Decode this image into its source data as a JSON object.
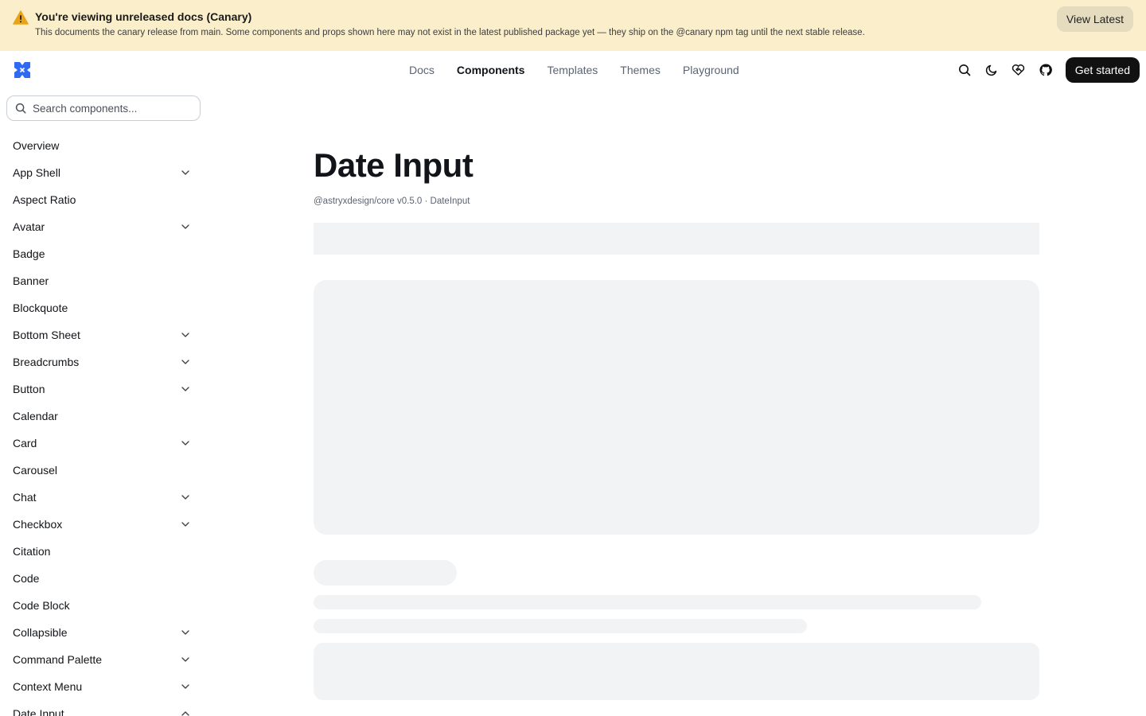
{
  "banner": {
    "title": "You're viewing unreleased docs (Canary)",
    "description": "This documents the canary release from main. Some components and props shown here may not exist in the latest published package yet — they ship on the @canary npm tag until the next stable release.",
    "button_label": "View Latest",
    "warning_color": "#e8a317"
  },
  "header": {
    "logo_icon": "logo-icon",
    "brand_color": "#2f6bf2",
    "nav": [
      "Docs",
      "Components",
      "Templates",
      "Themes",
      "Playground"
    ],
    "active_nav": "Components",
    "actions": [
      "search-icon",
      "theme-toggle-icon",
      "sponsor-icon",
      "github-icon"
    ],
    "cta_label": "Get started"
  },
  "sidebar": {
    "search_placeholder": "Search components...",
    "items": [
      {
        "label": "Overview",
        "expandable": false
      },
      {
        "label": "App Shell",
        "expandable": true
      },
      {
        "label": "Aspect Ratio",
        "expandable": false
      },
      {
        "label": "Avatar",
        "expandable": true
      },
      {
        "label": "Badge",
        "expandable": false
      },
      {
        "label": "Banner",
        "expandable": false
      },
      {
        "label": "Blockquote",
        "expandable": false
      },
      {
        "label": "Bottom Sheet",
        "expandable": true
      },
      {
        "label": "Breadcrumbs",
        "expandable": true
      },
      {
        "label": "Button",
        "expandable": true
      },
      {
        "label": "Calendar",
        "expandable": false
      },
      {
        "label": "Card",
        "expandable": true
      },
      {
        "label": "Carousel",
        "expandable": false
      },
      {
        "label": "Chat",
        "expandable": true
      },
      {
        "label": "Checkbox",
        "expandable": true
      },
      {
        "label": "Citation",
        "expandable": false
      },
      {
        "label": "Code",
        "expandable": false
      },
      {
        "label": "Code Block",
        "expandable": false
      },
      {
        "label": "Collapsible",
        "expandable": true
      },
      {
        "label": "Command Palette",
        "expandable": true
      },
      {
        "label": "Context Menu",
        "expandable": true
      },
      {
        "label": "Date Input",
        "expandable": true,
        "expanded": true
      }
    ]
  },
  "main": {
    "title": "Date Input",
    "meta": "@astryxdesign/core v0.5.0 · DateInput"
  }
}
